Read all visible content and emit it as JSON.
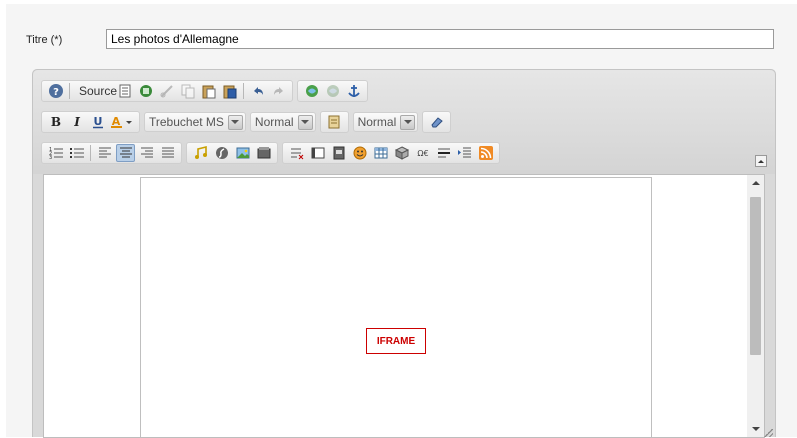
{
  "form": {
    "title_label": "Titre (*)",
    "title_value": "Les photos d'Allemagne"
  },
  "toolbar": {
    "row1": {
      "source_label": "Source"
    },
    "row2": {
      "font_family": "Trebuchet MS",
      "font_size": "Normal",
      "format": "Normal"
    }
  },
  "content": {
    "iframe_placeholder": "IFRAME"
  },
  "colors": {
    "toolbar_bg": "#d9d9d9",
    "active_button": "#b8cfe8",
    "iframe_marker": "#cc0000"
  }
}
